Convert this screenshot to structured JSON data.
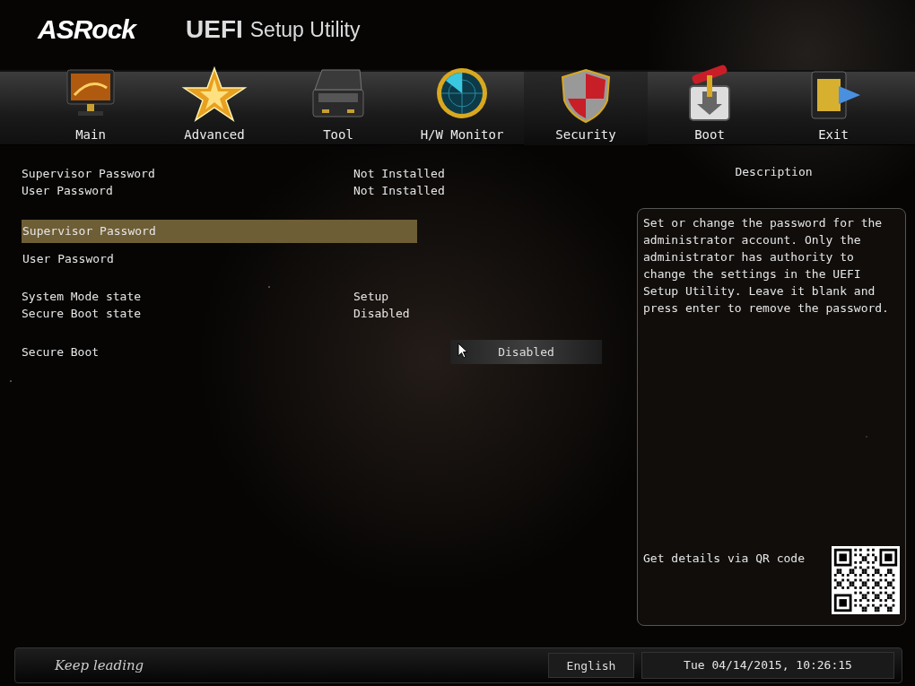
{
  "header": {
    "logo": "ASRock",
    "product": "UEFI",
    "title": "Setup Utility"
  },
  "tabs": [
    {
      "label": "Main",
      "selected": false
    },
    {
      "label": "Advanced",
      "selected": false
    },
    {
      "label": "Tool",
      "selected": false
    },
    {
      "label": "H/W Monitor",
      "selected": false
    },
    {
      "label": "Security",
      "selected": true
    },
    {
      "label": "Boot",
      "selected": false
    },
    {
      "label": "Exit",
      "selected": false
    }
  ],
  "groups": [
    {
      "rows": [
        {
          "kind": "info",
          "label": "Supervisor Password",
          "value": "Not Installed"
        },
        {
          "kind": "info",
          "label": "User Password",
          "value": "Not Installed"
        }
      ]
    },
    {
      "rows": [
        {
          "kind": "item",
          "label": "Supervisor Password",
          "selected": true
        },
        {
          "kind": "item",
          "label": "User Password",
          "selected": false
        }
      ]
    },
    {
      "rows": [
        {
          "kind": "info",
          "label": "System Mode state",
          "value": "Setup"
        },
        {
          "kind": "info",
          "label": "Secure Boot state",
          "value": "Disabled"
        }
      ]
    },
    {
      "rows": [
        {
          "kind": "option",
          "label": "Secure Boot",
          "value": "Disabled"
        }
      ]
    }
  ],
  "description": {
    "heading": "Description",
    "text": "Set or change the password for the administrator account. Only the administrator has authority to change the settings in the UEFI Setup Utility. Leave it blank and press enter to remove the password.",
    "qr_label": "Get details via QR code"
  },
  "footer": {
    "slogan": "Keep leading",
    "language": "English",
    "datetime": "Tue 04/14/2015, 10:26:15"
  }
}
